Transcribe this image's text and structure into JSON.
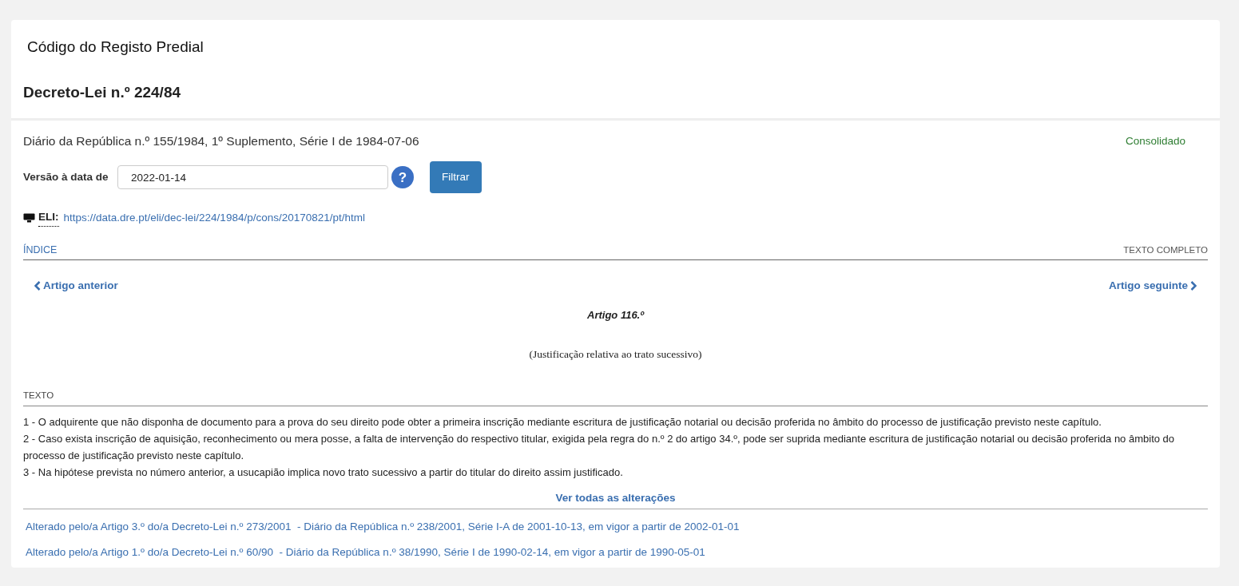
{
  "header": {
    "title": "Código do Registo Predial",
    "subtitle": "Decreto-Lei n.º 224/84"
  },
  "publication": "Diário da República n.º 155/1984, 1º Suplemento, Série I de 1984-07-06",
  "status": "Consolidado",
  "version_filter": {
    "label": "Versão à data de",
    "value": "2022-01-14",
    "help": "?",
    "button": "Filtrar"
  },
  "eli": {
    "label": "ELI:",
    "url": "https://data.dre.pt/eli/dec-lei/224/1984/p/cons/20170821/pt/html"
  },
  "tabs": [
    {
      "label": "ÍNDICE",
      "selected": false
    },
    {
      "label": "TEXTO COMPLETO",
      "selected": false
    }
  ],
  "navigation": {
    "previous": "Artigo anterior",
    "next": "Artigo seguinte"
  },
  "article": {
    "number": "Artigo 116.º",
    "epigraph": "(Justificação relativa ao trato sucessivo)",
    "section_label": "TEXTO",
    "paragraphs": [
      "1 - O adquirente que não disponha de documento para a prova do seu direito pode obter a primeira inscrição mediante escritura de justificação notarial ou decisão proferida no âmbito do processo de justificação previsto neste capítulo.",
      "2 - Caso exista inscrição de aquisição, reconhecimento ou mera posse, a falta de intervenção do respectivo titular, exigida pela regra do n.º 2 do artigo 34.º, pode ser suprida mediante escritura de justificação notarial ou decisão proferida no âmbito do processo de justificação previsto neste capítulo.",
      "3 - Na hipótese prevista no número anterior, a usucapião implica novo trato sucessivo a partir do titular do direito assim justificado."
    ]
  },
  "changes": {
    "link": "Ver todas as alterações",
    "items": [
      "Alterado pelo/a Artigo 3.º do/a Decreto-Lei n.º 273/2001  - Diário da República n.º 238/2001, Série I-A de 2001-10-13, em vigor a partir de 2002-01-01",
      "Alterado pelo/a Artigo 1.º do/a Decreto-Lei n.º 60/90  - Diário da República n.º 38/1990, Série I de 1990-02-14, em vigor a partir de 1990-05-01"
    ]
  }
}
